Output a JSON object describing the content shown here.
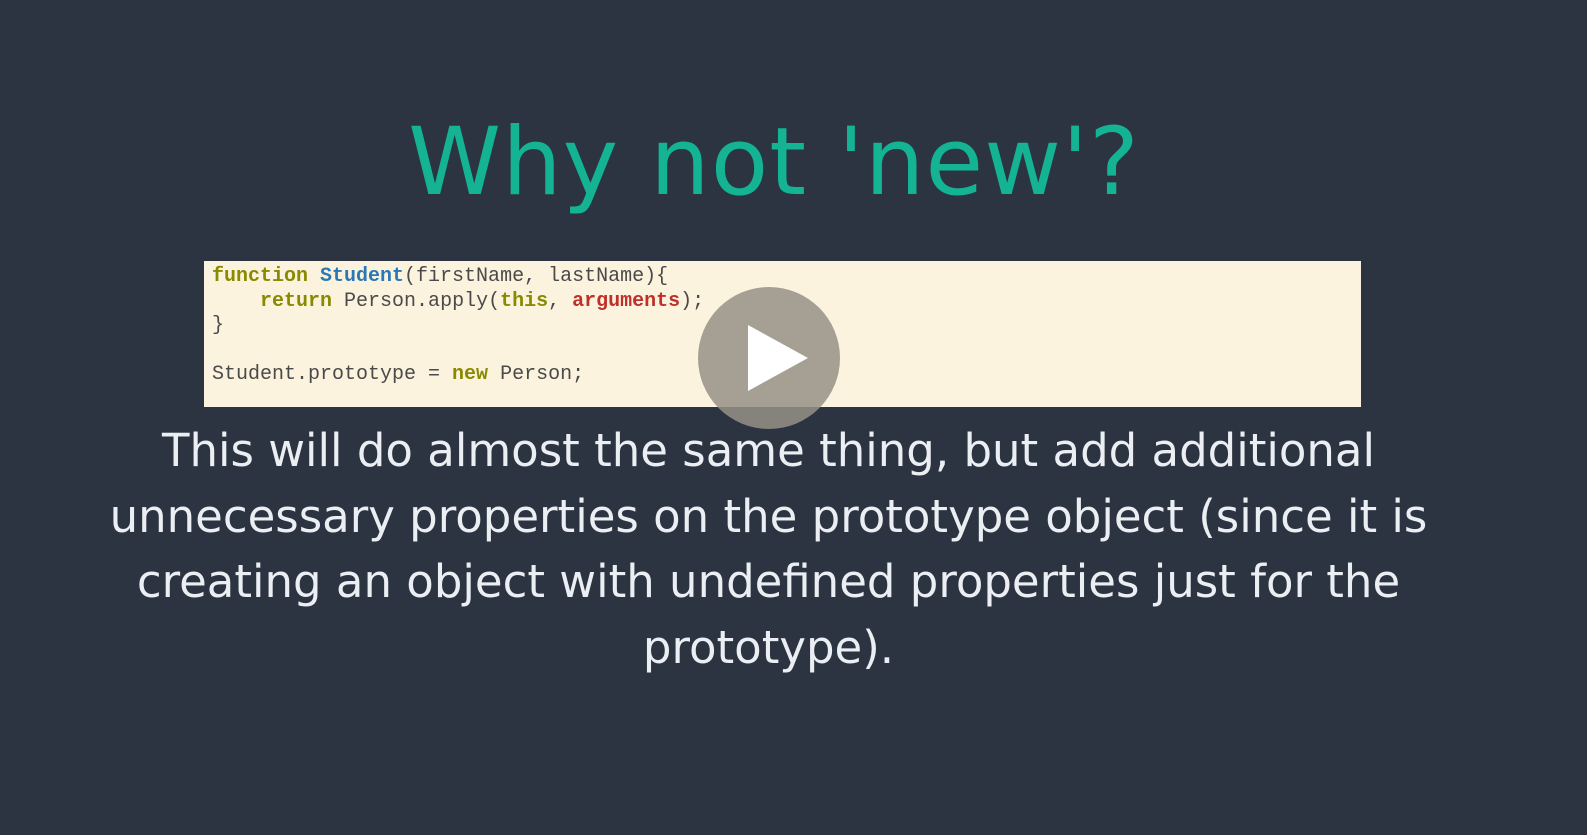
{
  "slide": {
    "title": "Why not 'new'?",
    "body": "This will do almost the same thing, but add additional unnecessary properties on the prototype object (since it is creating an object with undefined properties just for the prototype)."
  },
  "code": {
    "line1": {
      "keyword": "function",
      "name": "Student",
      "params": "(firstName, lastName){"
    },
    "line2": {
      "indent": "    ",
      "keyword": "return",
      "call": "Person.apply(",
      "this_kw": "this",
      "sep": ", ",
      "arguments_kw": "arguments",
      "end": ");"
    },
    "line3": "}",
    "line5": {
      "lhs": "Student.prototype = ",
      "keyword": "new",
      "rhs": "Person;"
    }
  },
  "player": {
    "play_icon": "play-icon"
  },
  "colors": {
    "background": "#2b3440",
    "title": "#14b394",
    "code_background": "#fcf3de",
    "body_text": "#ebeef2"
  }
}
